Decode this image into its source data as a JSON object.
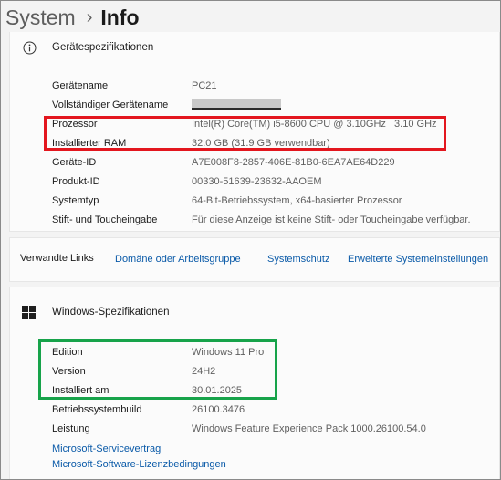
{
  "breadcrumb": {
    "parent": "System",
    "separator": "›",
    "current": "Info"
  },
  "device_section": {
    "title": "Gerätespezifikationen",
    "icon": "info-icon",
    "rows": [
      {
        "label": "Gerätename",
        "value": "PC21"
      },
      {
        "label": "Vollständiger Gerätename",
        "value": ""
      },
      {
        "label": "Prozessor",
        "value": "Intel(R) Core(TM) i5-8600 CPU @ 3.10GHz   3.10 GHz"
      },
      {
        "label": "Installierter RAM",
        "value": "32.0 GB (31.9 GB verwendbar)"
      },
      {
        "label": "Geräte-ID",
        "value": "A7E008F8-2857-406E-81B0-6EA7AE64D229"
      },
      {
        "label": "Produkt-ID",
        "value": "00330-51639-23632-AAOEM"
      },
      {
        "label": "Systemtyp",
        "value": "64-Bit-Betriebssystem, x64-basierter Prozessor"
      },
      {
        "label": "Stift- und Toucheingabe",
        "value": "Für diese Anzeige ist keine Stift- oder Toucheingabe verfügbar."
      }
    ]
  },
  "related_links": {
    "title": "Verwandte Links",
    "links": [
      "Domäne oder Arbeitsgruppe",
      "Systemschutz",
      "Erweiterte Systemeinstellungen"
    ]
  },
  "windows_section": {
    "title": "Windows-Spezifikationen",
    "icon": "windows-logo-icon",
    "rows": [
      {
        "label": "Edition",
        "value": "Windows 11 Pro"
      },
      {
        "label": "Version",
        "value": "24H2"
      },
      {
        "label": "Installiert am",
        "value": "30.01.2025"
      },
      {
        "label": "Betriebssystembuild",
        "value": "26100.3476"
      },
      {
        "label": "Leistung",
        "value": "Windows Feature Experience Pack 1000.26100.54.0"
      }
    ],
    "links": [
      "Microsoft-Servicevertrag",
      "Microsoft-Software-Lizenzbedingungen"
    ]
  },
  "colors": {
    "highlight_red": "#e3161e",
    "highlight_green": "#17a34a",
    "link": "#0a5aa8"
  }
}
